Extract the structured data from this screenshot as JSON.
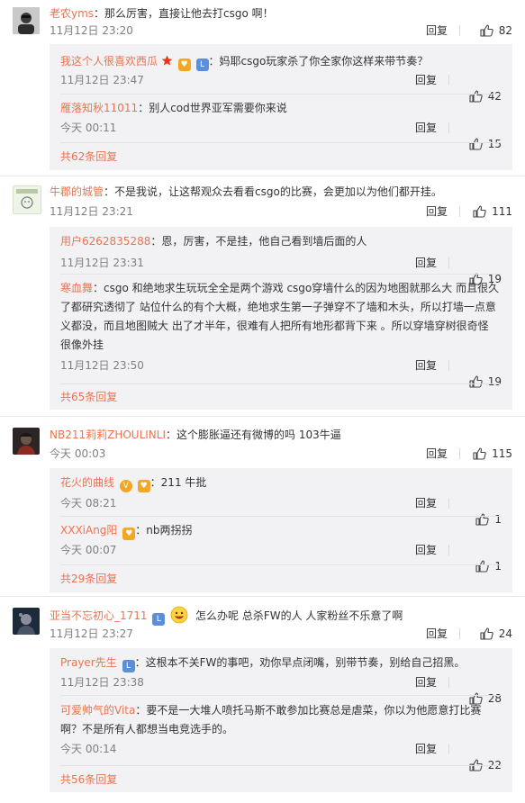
{
  "threads": [
    {
      "user": "老农yms",
      "text": "：那么厉害，直接让他去打csgo 啊！",
      "time": "11月12日 23:20",
      "likes": "82",
      "replies": [
        {
          "user": "我这个人很喜欢西瓜",
          "text": "：妈耶csgo玩家杀了你全家你这样来带节奏？",
          "time": "11月12日 23:47",
          "likes": "42"
        },
        {
          "user": "雁落知秋11011",
          "text": "：别人cod世界亚军需要你来说",
          "time": "今天 00:11",
          "likes": "15"
        }
      ],
      "more": "共62条回复"
    },
    {
      "user": "牛郡的城管",
      "text": "：不是我说，让这帮观众去看看csgo的比赛，会更加以为他们都开挂。",
      "time": "11月12日 23:21",
      "likes": "111",
      "replies": [
        {
          "user": "用户6262835288",
          "text": "：恩，厉害，不是挂，他自己看到墙后面的人",
          "time": "11月12日 23:31",
          "likes": "19"
        },
        {
          "user": "寒血舞",
          "text": "：csgo 和绝地求生玩玩全全是两个游戏 csgo穿墙什么的因为地图就那么大 而且很久了都研究透彻了 站位什么的有个大概，绝地求生第一子弹穿不了墙和木头，所以打墙一点意义都没，而且地图贼大 出了才半年，很难有人把所有地形都背下来 。所以穿墙穿树很奇怪 很像外挂",
          "time": "11月12日 23:50",
          "likes": "19"
        }
      ],
      "more": "共65条回复"
    },
    {
      "user": "NB211莉莉ZHOULINLI",
      "text": "：这个膨胀逼还有微博的吗 103牛逼",
      "time": "今天 00:03",
      "likes": "115",
      "replies": [
        {
          "user": "花火的曲线",
          "text": "：211 牛批",
          "time": "今天 08:21",
          "likes": "1"
        },
        {
          "user": "XXXiAng阳",
          "text": "：nb两拐拐",
          "time": "今天 00:07",
          "likes": "1"
        }
      ],
      "more": "共29条回复"
    },
    {
      "user": "亚当不忘初心_1711",
      "text": "怎么办呢  总杀FW的人   人家粉丝不乐意了啊",
      "time": "11月12日 23:27",
      "likes": "24",
      "replies": [
        {
          "user": "Prayer先生",
          "text": "：这根本不关FW的事吧，劝你早点闭嘴，别带节奏，别给自己招黑。",
          "time": "11月12日 23:38",
          "likes": "28"
        },
        {
          "user": "可爱帅气的Vita",
          "text": "：要不是一大堆人喷托马斯不敢参加比赛总是虐菜，你以为他愿意打比赛啊？不是所有人都想当电竞选手的。",
          "time": "今天 00:14",
          "likes": "22"
        }
      ],
      "more": "共56条回复"
    }
  ],
  "labels": {
    "reply": "回复"
  },
  "icons": {
    "like": "thumbs-up-icon",
    "star": "star-icon",
    "vip": "vip-v-icon",
    "emoji": "grin-emoji-icon"
  },
  "colors": {
    "name": "#eb7350",
    "sub_bg": "#f2f2f5",
    "star": "#e8361c",
    "vip": "#f5a623"
  }
}
